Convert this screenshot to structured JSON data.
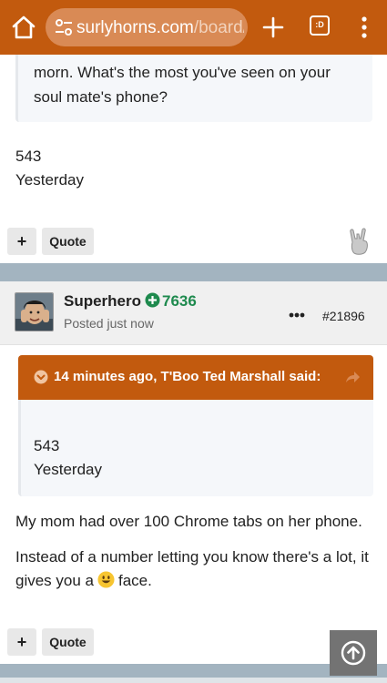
{
  "browser": {
    "url_host": "surlyhorns.com",
    "url_path": "/board/",
    "tab_switcher_label": ":D"
  },
  "previous_post": {
    "quote_tail": "morn.  What's the most you've seen on your soul mate's phone?",
    "body_line_1": "543",
    "body_line_2": "Yesterday",
    "plus_label": "+",
    "quote_label": "Quote"
  },
  "post": {
    "username": "Superhero",
    "reputation": "7636",
    "posted_time": "Posted just now",
    "post_number": "#21896",
    "quote_attribution": "14 minutes ago, T'Boo Ted Marshall said:",
    "quote_line_1": "543",
    "quote_line_2": "Yesterday",
    "paragraph_1": "My mom had over 100 Chrome tabs on her phone.",
    "paragraph_2_before": "Instead of a number letting you know there's a lot, it gives you a",
    "paragraph_2_after": "face.",
    "plus_label": "+",
    "quote_label": "Quote"
  },
  "icons": {
    "home": "home-icon",
    "tune": "site-settings-icon",
    "new_tab": "plus-icon",
    "menu": "more-vertical-icon",
    "rock": "rock-on-hand-icon",
    "rep": "plus-circle-icon",
    "more": "more-horizontal-icon",
    "collapse": "chevron-down-circle-icon",
    "share": "share-arrow-icon",
    "smiley": "smiley-emoji-icon",
    "scroll_top": "arrow-up-circle-icon"
  },
  "colors": {
    "brand": "#c25a0e",
    "reputation": "#1e8a4e",
    "divider": "#a3b4c0"
  }
}
